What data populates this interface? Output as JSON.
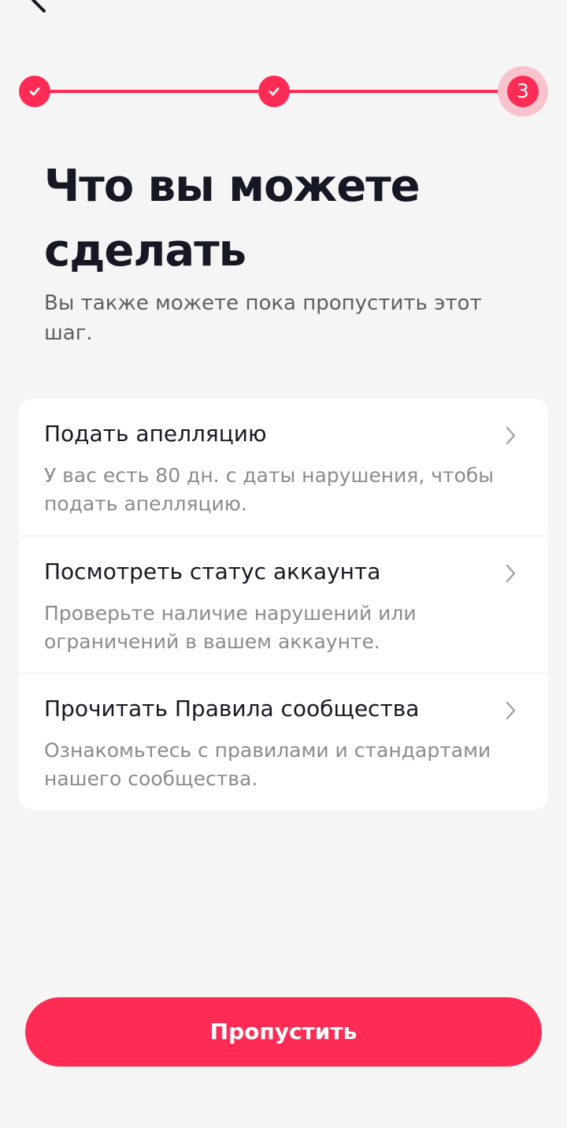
{
  "header": {
    "back_icon": "chevron-left-icon"
  },
  "stepper": {
    "total_steps": 3,
    "current_step": 3,
    "completed_icon": "check-icon",
    "current_label": "3",
    "active_color": "#fe2c55",
    "halo_color": "#f8c3cc"
  },
  "main": {
    "title": "Что вы можете сделать",
    "subtitle": "Вы также можете пока пропустить этот шаг."
  },
  "options": [
    {
      "title": "Подать апелляцию",
      "description": "У вас есть 80 дн. с даты нарушения, чтобы подать апелляцию.",
      "icon": "chevron-right-icon"
    },
    {
      "title": "Посмотреть статус аккаунта",
      "description": "Проверьте наличие нарушений или ограничений в вашем аккаунте.",
      "icon": "chevron-right-icon"
    },
    {
      "title": "Прочитать Правила сообщества",
      "description": "Ознакомьтесь с правилами и стандартами нашего сообщества.",
      "icon": "chevron-right-icon"
    }
  ],
  "footer": {
    "skip_label": "Пропустить",
    "button_color": "#fe2c55"
  }
}
